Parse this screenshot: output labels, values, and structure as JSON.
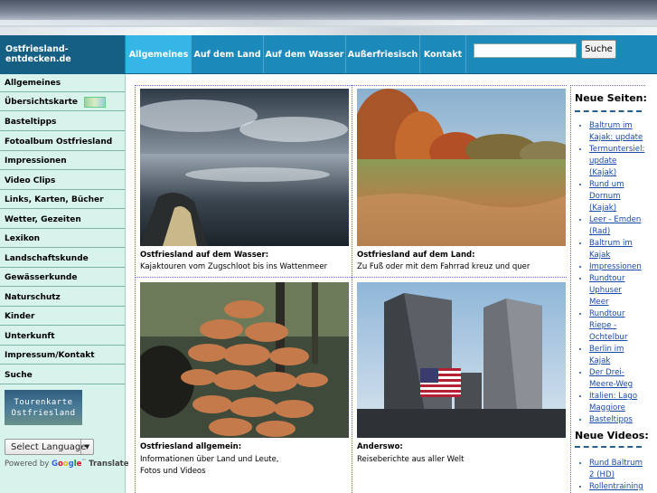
{
  "nav": {
    "brand": "Ostfriesland-entdecken.de",
    "items": [
      {
        "label": "Allgemeines",
        "active": true
      },
      {
        "label": "Auf dem Land",
        "active": false
      },
      {
        "label": "Auf dem Wasser",
        "active": false
      },
      {
        "label": "Außerfriesisch",
        "active": false
      },
      {
        "label": "Kontakt",
        "active": false
      }
    ],
    "search_button": "Suche",
    "search_value": ""
  },
  "sidebar": {
    "items": [
      {
        "label": "Allgemeines"
      },
      {
        "label": "Übersichtskarte"
      },
      {
        "label": "Basteltipps"
      },
      {
        "label": "Fotoalbum Ostfriesland"
      },
      {
        "label": "Impressionen"
      },
      {
        "label": "Video Clips"
      },
      {
        "label": "Links, Karten, Bücher"
      },
      {
        "label": "Wetter, Gezeiten"
      },
      {
        "label": "Lexikon"
      },
      {
        "label": "Landschaftskunde"
      },
      {
        "label": "Gewässerkunde"
      },
      {
        "label": "Naturschutz"
      },
      {
        "label": "Kinder"
      },
      {
        "label": "Unterkunft"
      },
      {
        "label": "Impressum/Kontakt"
      },
      {
        "label": "Suche"
      }
    ],
    "tourenkarte": {
      "line1": "Tourenkarte",
      "line2": "Ostfriesland"
    },
    "language": {
      "select_label": "Select Language",
      "powered_by": "Powered by",
      "google": [
        "G",
        "o",
        "o",
        "g",
        "l",
        "e"
      ],
      "tm": "™",
      "translate": "Translate"
    }
  },
  "tiles": [
    {
      "title": "Ostfriesland auf dem Wasser:",
      "text": "Kajaktouren vom Zugschloot bis ins Wattenmeer"
    },
    {
      "title": "Ostfriesland auf dem Land:",
      "text": "Zu Fuß oder mit dem Fahrrad kreuz und quer"
    },
    {
      "title": "Ostfriesland allgemein:",
      "text_lines": [
        "Informationen über Land und Leute,",
        "Fotos und Videos"
      ]
    },
    {
      "title": "Anderswo:",
      "text": "Reiseberichte aus aller Welt"
    }
  ],
  "right": {
    "new_pages_title": "Neue Seiten:",
    "new_pages": [
      "Baltrum im Kajak: update",
      "Termuntersiel: update (Kajak)",
      "Rund um Dornum (Kajak)",
      "Leer - Emden (Rad)",
      "Baltrum im Kajak",
      "Impressionen",
      "Rundtour Uphuser Meer",
      "Rundtour Riepe - Ochtelbur",
      "Berlin im Kajak",
      "Der Drei-Meere-Weg",
      "Italien: Lago Maggiore",
      "Basteltipps"
    ],
    "new_videos_title": "Neue Videos:",
    "new_videos": [
      "Rund Baltrum 2 (HD)",
      "Rollentraining"
    ]
  }
}
